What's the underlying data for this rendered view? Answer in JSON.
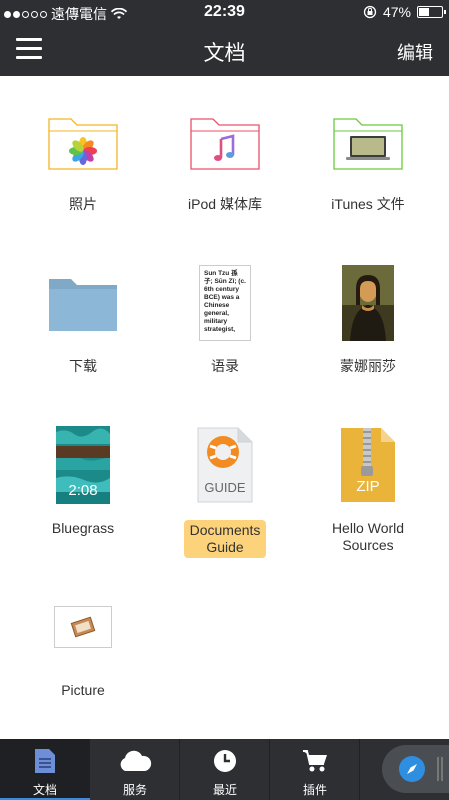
{
  "status_bar": {
    "carrier": "遠傳電信",
    "time": "22:39",
    "battery": "47%",
    "battery_level": 0.47
  },
  "header": {
    "title": "文档",
    "edit_label": "编辑"
  },
  "files": [
    {
      "label": "照片",
      "icon": "photos-folder-icon"
    },
    {
      "label": "iPod 媒体库",
      "icon": "music-folder-icon"
    },
    {
      "label": "iTunes 文件",
      "icon": "itunes-folder-icon"
    },
    {
      "label": "下载",
      "icon": "folder-icon"
    },
    {
      "label": "语录",
      "icon": "text-document-icon",
      "preview": "Sun Tzu 孫子; Sūn Zǐ; (c. 6th century BCE) was a Chinese general, military strategist,"
    },
    {
      "label": "蒙娜丽莎",
      "icon": "image-thumbnail-icon"
    },
    {
      "label": "Bluegrass",
      "icon": "video-thumbnail-icon",
      "duration": "2:08"
    },
    {
      "label": "Documents\nGuide",
      "icon": "guide-document-icon",
      "badge": "GUIDE"
    },
    {
      "label": "Hello World\nSources",
      "icon": "zip-archive-icon",
      "badge": "ZIP"
    },
    {
      "label": "Picture",
      "icon": "picture-file-icon"
    }
  ],
  "tabs": [
    {
      "label": "文档",
      "icon": "document-icon",
      "active": true
    },
    {
      "label": "服务",
      "icon": "cloud-icon"
    },
    {
      "label": "最近",
      "icon": "clock-icon"
    },
    {
      "label": "插件",
      "icon": "cart-icon"
    }
  ],
  "browser_button": {
    "icon": "compass-icon"
  },
  "colors": {
    "bar_bg": "#2d2f33",
    "active_tab_underline": "#3b8bdc",
    "selection_highlight": "#fcd37b"
  }
}
